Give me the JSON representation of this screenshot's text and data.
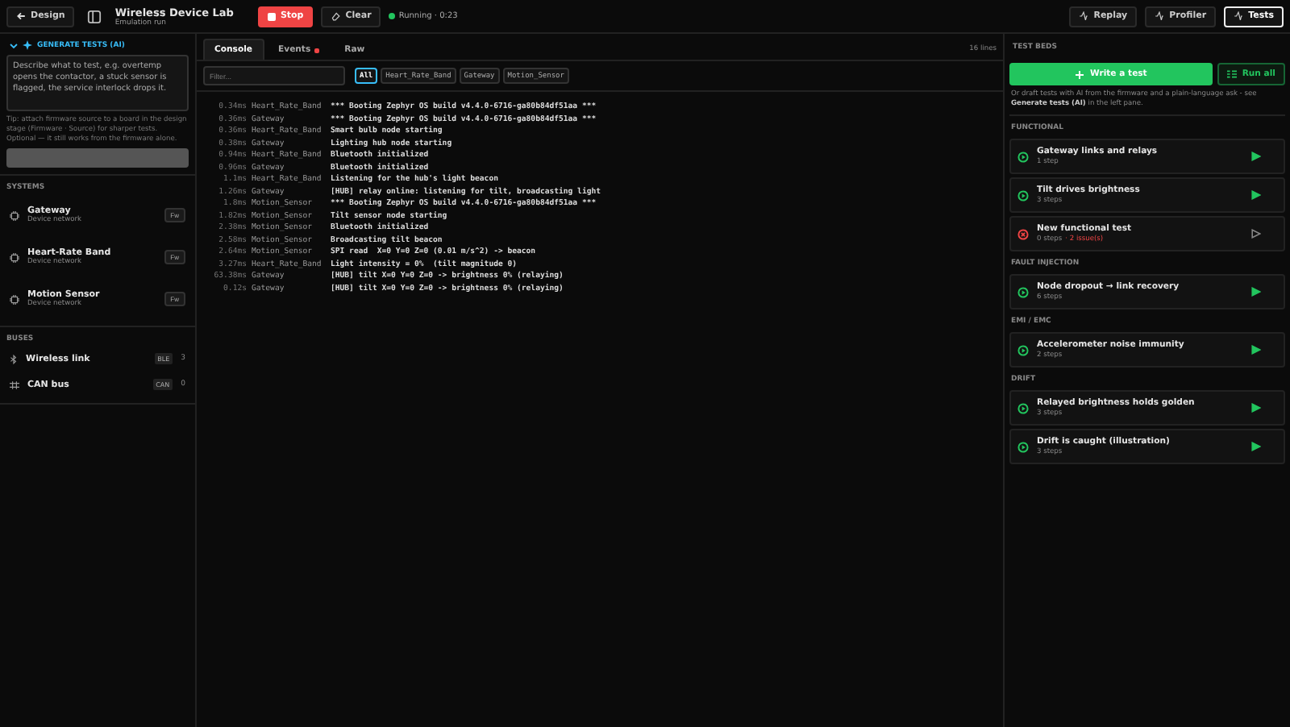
{
  "topbar": {
    "back_button": "Design",
    "title": "Wireless Device Lab",
    "subtitle": "Emulation run",
    "stop_button": "Stop",
    "clear_button": "Clear",
    "status": "Running · 0:23",
    "running": true,
    "right_buttons": [
      {
        "label": "Replay",
        "selected": false
      },
      {
        "label": "Profiler",
        "selected": false
      },
      {
        "label": "Tests",
        "selected": true
      }
    ]
  },
  "sidebar": {
    "generate": {
      "title": "GENERATE TESTS (AI)",
      "expanded": true,
      "placeholder": "Describe what to test, e.g. overtemp opens the contactor, a stuck sensor is flagged, the service interlock drops it.",
      "tip": "Tip: attach firmware source to a board in the design stage (Firmware · Source) for sharper tests. Optional — it still works from the firmware alone.",
      "button_disabled": true
    },
    "systems_heading": "SYSTEMS",
    "systems": [
      {
        "name": "Gateway",
        "sub": "Device network",
        "action": "Fw"
      },
      {
        "name": "Heart-Rate Band",
        "sub": "Device network",
        "action": "Fw"
      },
      {
        "name": "Motion Sensor",
        "sub": "Device network",
        "action": "Fw"
      }
    ],
    "buses_heading": "BUSES",
    "buses": [
      {
        "kind": "wireless",
        "name": "Wireless link",
        "tag": "BLE",
        "count": "3"
      },
      {
        "kind": "wired",
        "name": "CAN bus",
        "tag": "CAN",
        "count": "0"
      }
    ]
  },
  "console": {
    "tabs": [
      {
        "label": "Console",
        "selected": true,
        "alert": false
      },
      {
        "label": "Events",
        "selected": false,
        "alert": true
      },
      {
        "label": "Raw",
        "selected": false,
        "alert": false
      }
    ],
    "line_count": "16 lines",
    "filter_placeholder": "Filter...",
    "chips": [
      {
        "label": "All",
        "selected": true
      },
      {
        "label": "Heart_Rate_Band",
        "selected": false
      },
      {
        "label": "Gateway",
        "selected": false
      },
      {
        "label": "Motion_Sensor",
        "selected": false
      }
    ],
    "lines": [
      {
        "time": "0.34ms",
        "source": "Heart_Rate_Band",
        "text": "*** Booting Zephyr OS build v4.4.0-6716-ga80b84df51aa ***"
      },
      {
        "time": "0.36ms",
        "source": "Gateway",
        "text": "*** Booting Zephyr OS build v4.4.0-6716-ga80b84df51aa ***"
      },
      {
        "time": "0.36ms",
        "source": "Heart_Rate_Band",
        "text": "Smart bulb node starting"
      },
      {
        "time": "0.38ms",
        "source": "Gateway",
        "text": "Lighting hub node starting"
      },
      {
        "time": "0.94ms",
        "source": "Heart_Rate_Band",
        "text": "Bluetooth initialized"
      },
      {
        "time": "0.96ms",
        "source": "Gateway",
        "text": "Bluetooth initialized"
      },
      {
        "time": "1.1ms",
        "source": "Heart_Rate_Band",
        "text": "Listening for the hub's light beacon"
      },
      {
        "time": "1.26ms",
        "source": "Gateway",
        "text": "[HUB] relay online: listening for tilt, broadcasting light"
      },
      {
        "time": "1.8ms",
        "source": "Motion_Sensor",
        "text": "*** Booting Zephyr OS build v4.4.0-6716-ga80b84df51aa ***"
      },
      {
        "time": "1.82ms",
        "source": "Motion_Sensor",
        "text": "Tilt sensor node starting"
      },
      {
        "time": "2.38ms",
        "source": "Motion_Sensor",
        "text": "Bluetooth initialized"
      },
      {
        "time": "2.58ms",
        "source": "Motion_Sensor",
        "text": "Broadcasting tilt beacon"
      },
      {
        "time": "2.64ms",
        "source": "Motion_Sensor",
        "text": "SPI read  X=0 Y=0 Z=0 (0.01 m/s^2) -> beacon"
      },
      {
        "time": "3.27ms",
        "source": "Heart_Rate_Band",
        "text": "Light intensity = 0%  (tilt magnitude 0)"
      },
      {
        "time": "63.38ms",
        "source": "Gateway",
        "text": "[HUB] tilt X=0 Y=0 Z=0 -> brightness 0% (relaying)"
      },
      {
        "time": "0.12s",
        "source": "Gateway",
        "text": "[HUB] tilt X=0 Y=0 Z=0 -> brightness 0% (relaying)"
      }
    ]
  },
  "tests": {
    "heading": "TEST BEDS",
    "write_button": "Write a test",
    "run_all_button": "Run all",
    "hint": "Or draft tests with AI from the firmware and a plain-language ask - see **Generate tests (AI)** in the left pane.",
    "groups": [
      {
        "title": "FUNCTIONAL",
        "items": [
          {
            "name": "Gateway links and relays",
            "steps": "1 step",
            "passed": true,
            "runnable": true
          },
          {
            "name": "Tilt drives brightness",
            "steps": "3 steps",
            "passed": true,
            "runnable": true
          },
          {
            "name": "New functional test",
            "steps": "0 steps",
            "passed": false,
            "issues": "· 2 issue(s)",
            "runnable": false
          }
        ]
      },
      {
        "title": "FAULT INJECTION",
        "items": [
          {
            "name": "Node dropout → link recovery",
            "steps": "6 steps",
            "passed": true,
            "runnable": true
          }
        ]
      },
      {
        "title": "EMI / EMC",
        "items": [
          {
            "name": "Accelerometer noise immunity",
            "steps": "2 steps",
            "passed": true,
            "runnable": true
          }
        ]
      },
      {
        "title": "DRIFT",
        "items": [
          {
            "name": "Relayed brightness holds golden",
            "steps": "3 steps",
            "passed": true,
            "runnable": true
          },
          {
            "name": "Drift is caught (illustration)",
            "steps": "3 steps",
            "passed": true,
            "runnable": true
          }
        ]
      }
    ]
  }
}
